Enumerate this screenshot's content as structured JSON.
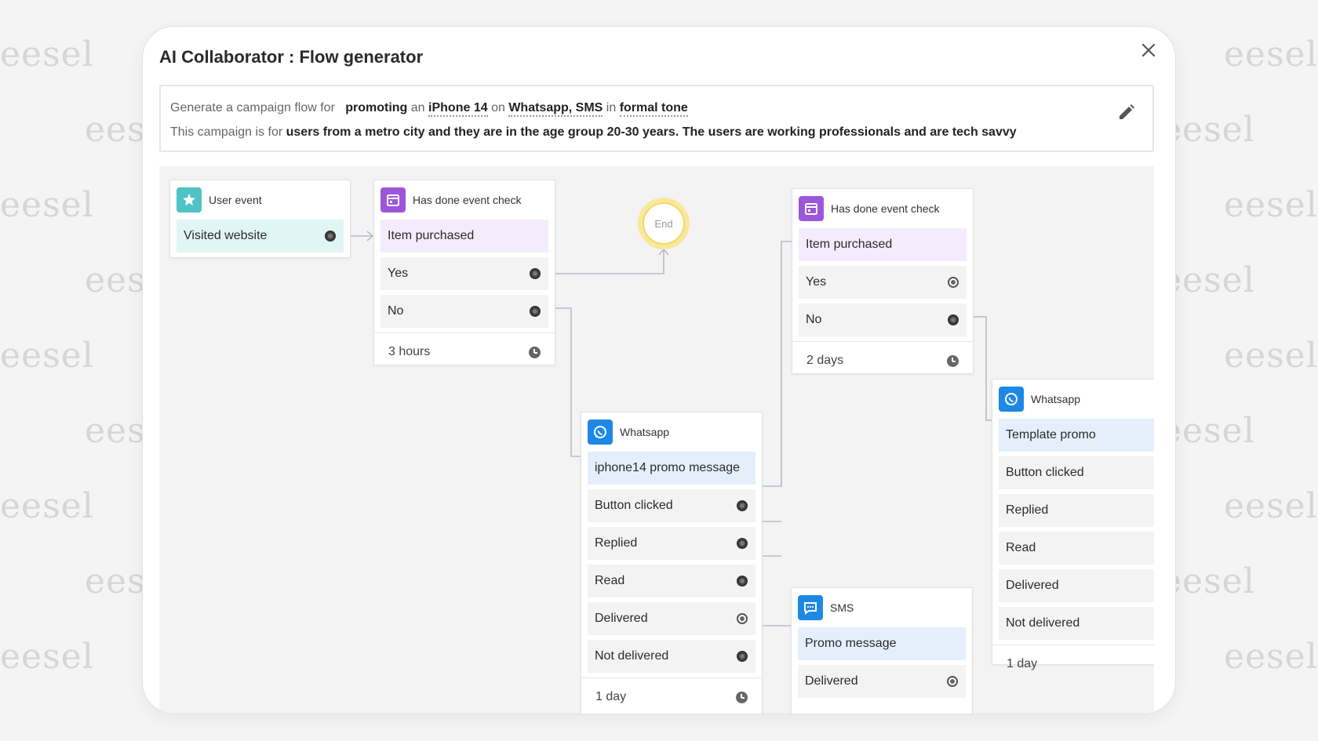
{
  "watermark": "eesel",
  "modal": {
    "title": "AI Collaborator : Flow generator"
  },
  "prompt": {
    "line1": {
      "p1": "Generate a campaign flow for",
      "goal": "promoting",
      "p2": "an",
      "product": "iPhone 14",
      "p3": "on",
      "channels": "Whatsapp, SMS",
      "p4": "in",
      "tone": "formal tone"
    },
    "line2": {
      "p1": "This campaign is for",
      "audience": "users from a metro city and they are in the age group 20-30 years. The users are working professionals and are tech savvy"
    }
  },
  "nodes": {
    "user_event": {
      "title": "User event",
      "icon": "star-icon",
      "main": "Visited website"
    },
    "check1": {
      "title": "Has done event check",
      "icon": "calendar-icon",
      "main": "Item purchased",
      "yes": "Yes",
      "no": "No",
      "wait": "3 hours"
    },
    "end": {
      "label": "End"
    },
    "whatsapp1": {
      "title": "Whatsapp",
      "icon": "whatsapp-icon",
      "main": "iphone14 promo message",
      "outcomes": [
        "Button clicked",
        "Replied",
        "Read",
        "Delivered",
        "Not delivered"
      ],
      "wait": "1 day"
    },
    "check2": {
      "title": "Has done event check",
      "icon": "calendar-icon",
      "main": "Item purchased",
      "yes": "Yes",
      "no": "No",
      "wait": "2 days"
    },
    "sms": {
      "title": "SMS",
      "icon": "sms-icon",
      "main": "Promo message",
      "outcomes": [
        "Delivered"
      ]
    },
    "whatsapp2": {
      "title": "Whatsapp",
      "icon": "whatsapp-icon",
      "main": "Template promo",
      "outcomes": [
        "Button clicked",
        "Replied",
        "Read",
        "Delivered",
        "Not delivered"
      ],
      "wait": "1 day"
    }
  },
  "colors": {
    "accent_teal": "#4fc3c6",
    "accent_purple": "#9c57d9",
    "accent_blue": "#1e88e5",
    "end_ring": "#f8e89a"
  }
}
